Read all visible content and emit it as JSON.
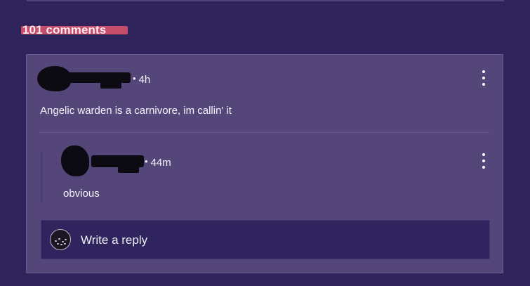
{
  "comments_section": {
    "count_label": "101 comments"
  },
  "comment": {
    "timestamp": "4h",
    "text": "Angelic warden is a carnivore, im callin' it",
    "reply": {
      "timestamp": "44m",
      "text": "obvious"
    }
  },
  "reply_box": {
    "placeholder": "Write a reply"
  },
  "icons": {
    "menu": "more-vertical-icon",
    "avatar": "user-avatar"
  },
  "colors": {
    "background": "#2f235c",
    "card": "#544679",
    "reply_box": "#30245e",
    "highlight": "#d2516d"
  }
}
